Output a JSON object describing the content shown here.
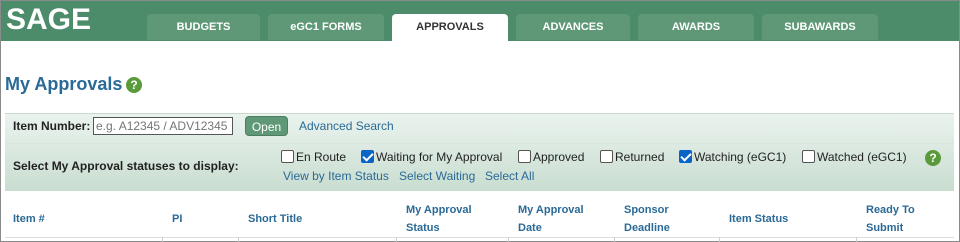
{
  "app": {
    "logo": "SAGE"
  },
  "tabs": [
    {
      "label": "BUDGETS",
      "active": false
    },
    {
      "label": "eGC1 FORMS",
      "active": false
    },
    {
      "label": "APPROVALS",
      "active": true
    },
    {
      "label": "ADVANCES",
      "active": false
    },
    {
      "label": "AWARDS",
      "active": false
    },
    {
      "label": "SUBAWARDS",
      "active": false
    }
  ],
  "page": {
    "title": "My Approvals",
    "help": "?"
  },
  "search": {
    "label": "Item Number:",
    "placeholder": "e.g. A12345 / ADV12345",
    "open_label": "Open",
    "advanced_link": "Advanced Search"
  },
  "statuses": {
    "label": "Select My Approval statuses to display:",
    "options": [
      {
        "label": "En Route",
        "checked": false
      },
      {
        "label": "Waiting for My Approval",
        "checked": true
      },
      {
        "label": "Approved",
        "checked": false
      },
      {
        "label": "Returned",
        "checked": false
      },
      {
        "label": "Watching (eGC1)",
        "checked": true
      },
      {
        "label": "Watched (eGC1)",
        "checked": false
      }
    ],
    "links": [
      "View by Item Status",
      "Select Waiting",
      "Select All"
    ],
    "help": "?"
  },
  "table": {
    "columns": [
      {
        "line1": "Item #",
        "line2": ""
      },
      {
        "line1": "PI",
        "line2": ""
      },
      {
        "line1": "Short Title",
        "line2": ""
      },
      {
        "line1": "My Approval",
        "line2": "Status"
      },
      {
        "line1": "My Approval",
        "line2": "Date"
      },
      {
        "line1": "Sponsor",
        "line2": "Deadline"
      },
      {
        "line1": "Item Status",
        "line2": ""
      },
      {
        "line1": "Ready To",
        "line2": "Submit"
      }
    ]
  },
  "colors": {
    "brand_green": "#4c8c6a",
    "link_blue": "#2a6a96",
    "checkbox_blue": "#0a64c8"
  }
}
